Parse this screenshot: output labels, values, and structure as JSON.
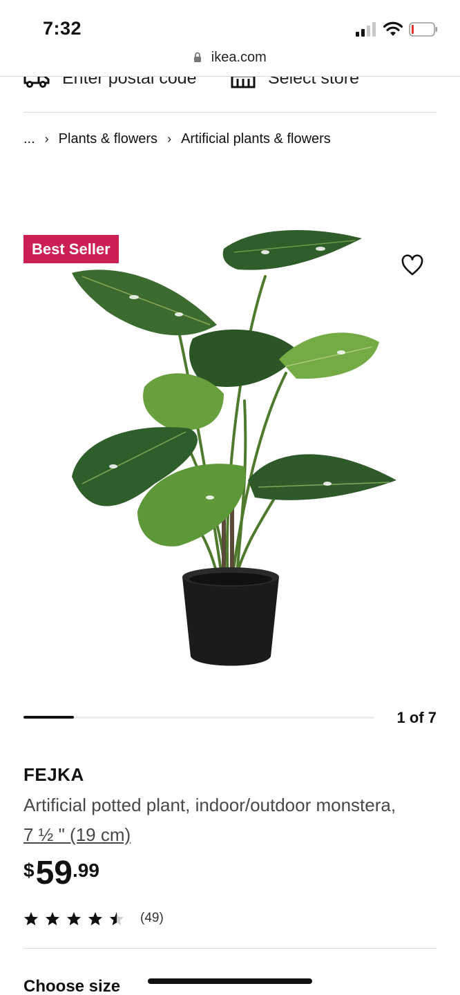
{
  "status_bar": {
    "time": "7:32"
  },
  "browser": {
    "domain": "ikea.com"
  },
  "utility": {
    "postal_label": "Enter postal code",
    "store_label": "Select store"
  },
  "breadcrumb": {
    "ellipsis": "...",
    "items": [
      "Plants & flowers",
      "Artificial plants & flowers"
    ]
  },
  "media": {
    "badge": "Best Seller",
    "carousel_position": "1 of 7",
    "carousel_progress": 0.143
  },
  "product": {
    "name": "FEJKA",
    "description": "Artificial potted plant, indoor/outdoor monstera,",
    "size": "7 ½ \" (19 cm)",
    "price": {
      "currency": "$",
      "integer": "59",
      "decimals": ".99"
    },
    "rating": {
      "stars": 4.5,
      "max": 5,
      "count": "(49)"
    }
  },
  "sections": {
    "choose_size": "Choose size"
  },
  "colors": {
    "badge": "#cc1f54",
    "text": "#111111",
    "muted": "#484848"
  }
}
